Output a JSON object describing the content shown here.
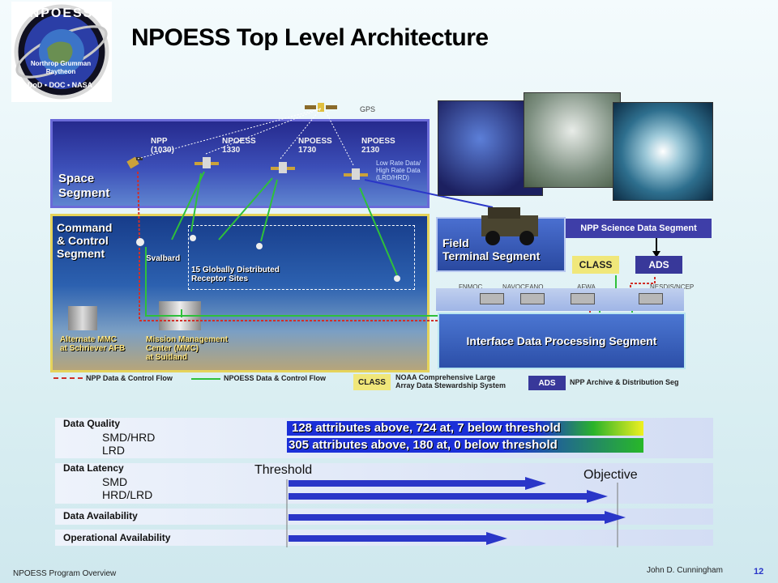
{
  "title": "NPOESS Top Level Architecture",
  "logo": {
    "top_text": "NPOESS",
    "mid_text": "Northrop Grumman",
    "mid_text2": "Raytheon",
    "bottom_text": "DoD • DOC • NASA"
  },
  "gps_label": "GPS",
  "space_segment": {
    "title_line1": "Space",
    "title_line2": "Segment",
    "satellites": [
      {
        "name": "NPP",
        "sub": "(1030)"
      },
      {
        "name": "NPOESS",
        "sub": "1330"
      },
      {
        "name": "NPOESS",
        "sub": "1730"
      },
      {
        "name": "NPOESS",
        "sub": "2130"
      }
    ],
    "data_rate_note": [
      "Low Rate Data/",
      "High Rate Data",
      "(LRD/HRD)"
    ]
  },
  "command_segment": {
    "title_lines": [
      "Command",
      "& Control",
      "Segment"
    ],
    "svalbard": "Svalbard",
    "receptor_sites": [
      "15 Globally Distributed",
      "Receptor Sites"
    ],
    "alt_mmc": [
      "Alternate MMC",
      "at Schriever AFB"
    ],
    "mmc": [
      "Mission Management",
      "Center (MMC)",
      "at Suitland"
    ]
  },
  "field_terminal": {
    "line1": "Field",
    "line2": "Terminal Segment"
  },
  "npp_science": "NPP Science Data Segment",
  "class_label": "CLASS",
  "ads_label": "ADS",
  "centrals": [
    "FNMOC",
    "NAVOCEANO",
    "AFWA",
    "NESDIS/NCEP"
  ],
  "idps": "Interface Data Processing Segment",
  "legend": {
    "npp_flow": "NPP Data & Control Flow",
    "npoess_flow": "NPOESS Data & Control Flow",
    "class_box": "CLASS",
    "class_desc": [
      "NOAA Comprehensive Large",
      "Array Data Stewardship System"
    ],
    "ads_box": "ADS",
    "ads_desc": "NPP Archive & Distribution Seg"
  },
  "metrics": {
    "data_quality": {
      "label": "Data Quality",
      "sub1": "SMD/HRD",
      "sub2": "LRD",
      "bar1": "128 attributes above, 724 at, 7 below threshold",
      "bar2": " 305 attributes above, 180 at, 0 below threshold"
    },
    "data_latency": {
      "label": "Data Latency",
      "sub1": "SMD",
      "sub2": "HRD/LRD"
    },
    "data_availability": {
      "label": "Data Availability"
    },
    "operational_availability": {
      "label": "Operational Availability"
    },
    "threshold_label": "Threshold",
    "objective_label": "Objective"
  },
  "footer": {
    "left": "NPOESS  Program Overview",
    "author": "John D. Cunningham",
    "page": "12"
  },
  "colors": {
    "space_border": "#6a6ad8",
    "cmd_border": "#e5d35b",
    "npp_flow": "#d0302a",
    "npoess_flow": "#2fc03a",
    "class_fill": "#f0e77a",
    "ads_fill": "#38389a",
    "quality_bar1": "#1b2fd8",
    "quality_bar2": "#28b828",
    "arrow_blue": "#2a36c8"
  }
}
